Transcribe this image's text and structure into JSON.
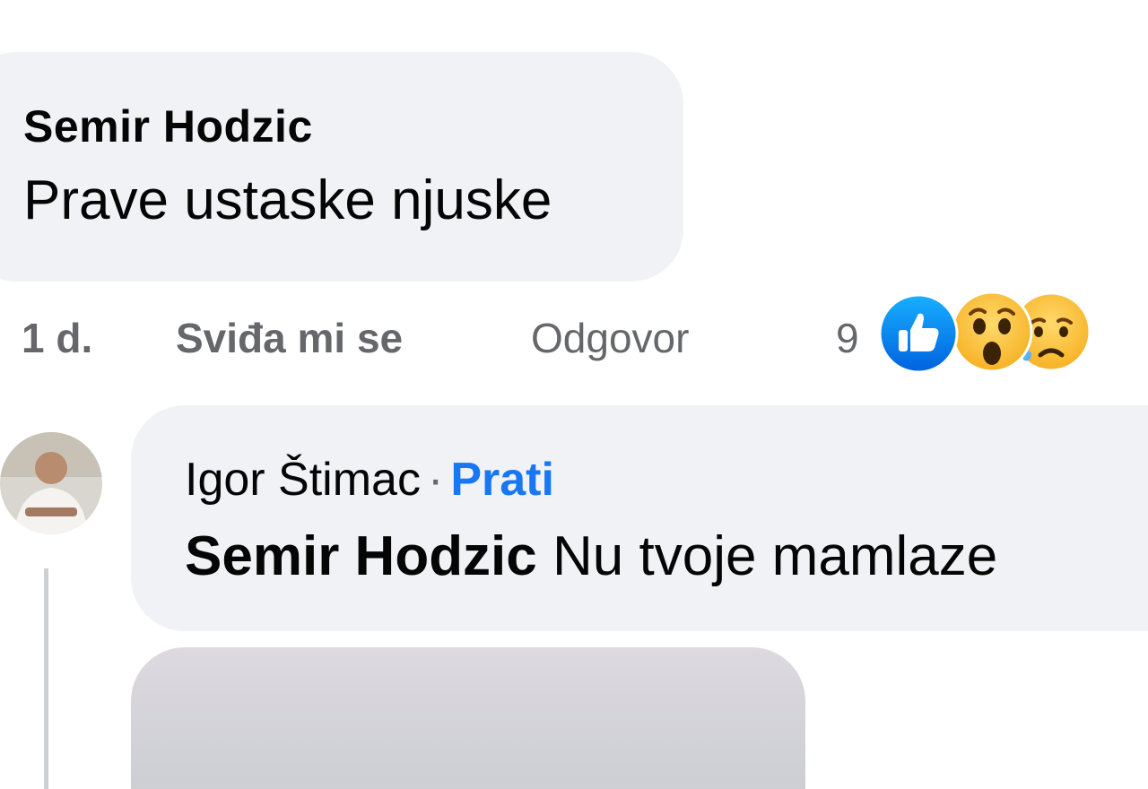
{
  "comment": {
    "author": "Semir Hodzic",
    "text": "Prave ustaske njuske",
    "time": "1 d.",
    "like_label": "Sviđa mi se",
    "reply_label": "Odgovor",
    "reaction_count": "9",
    "reactions": [
      "like-icon",
      "wow-icon",
      "sad-icon"
    ]
  },
  "reply": {
    "author": "Igor Štimac",
    "separator": "·",
    "follow_label": "Prati",
    "mention": "Semir Hodzic",
    "text": "Nu tvoje mamlaze"
  },
  "colors": {
    "bubble": "#f0f2f5",
    "text": "#050505",
    "muted": "#65676b",
    "link": "#1877f2"
  }
}
